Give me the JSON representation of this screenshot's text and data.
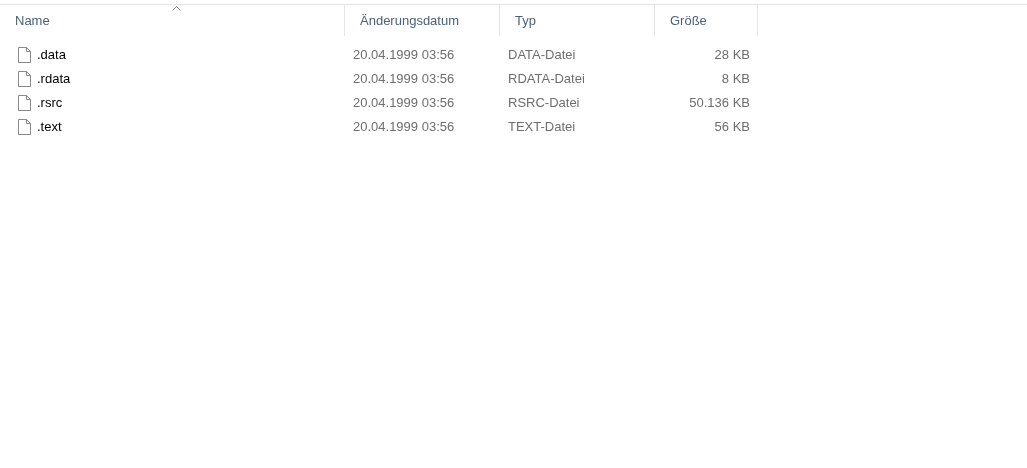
{
  "columns": [
    {
      "label": "Name",
      "sorted": true
    },
    {
      "label": "Änderungsdatum",
      "sorted": false
    },
    {
      "label": "Typ",
      "sorted": false
    },
    {
      "label": "Größe",
      "sorted": false
    }
  ],
  "rows": [
    {
      "name": ".data",
      "modified": "20.04.1999 03:56",
      "type": "DATA-Datei",
      "size": "28 KB"
    },
    {
      "name": ".rdata",
      "modified": "20.04.1999 03:56",
      "type": "RDATA-Datei",
      "size": "8 KB"
    },
    {
      "name": ".rsrc",
      "modified": "20.04.1999 03:56",
      "type": "RSRC-Datei",
      "size": "50.136 KB"
    },
    {
      "name": ".text",
      "modified": "20.04.1999 03:56",
      "type": "TEXT-Datei",
      "size": "56 KB"
    }
  ]
}
